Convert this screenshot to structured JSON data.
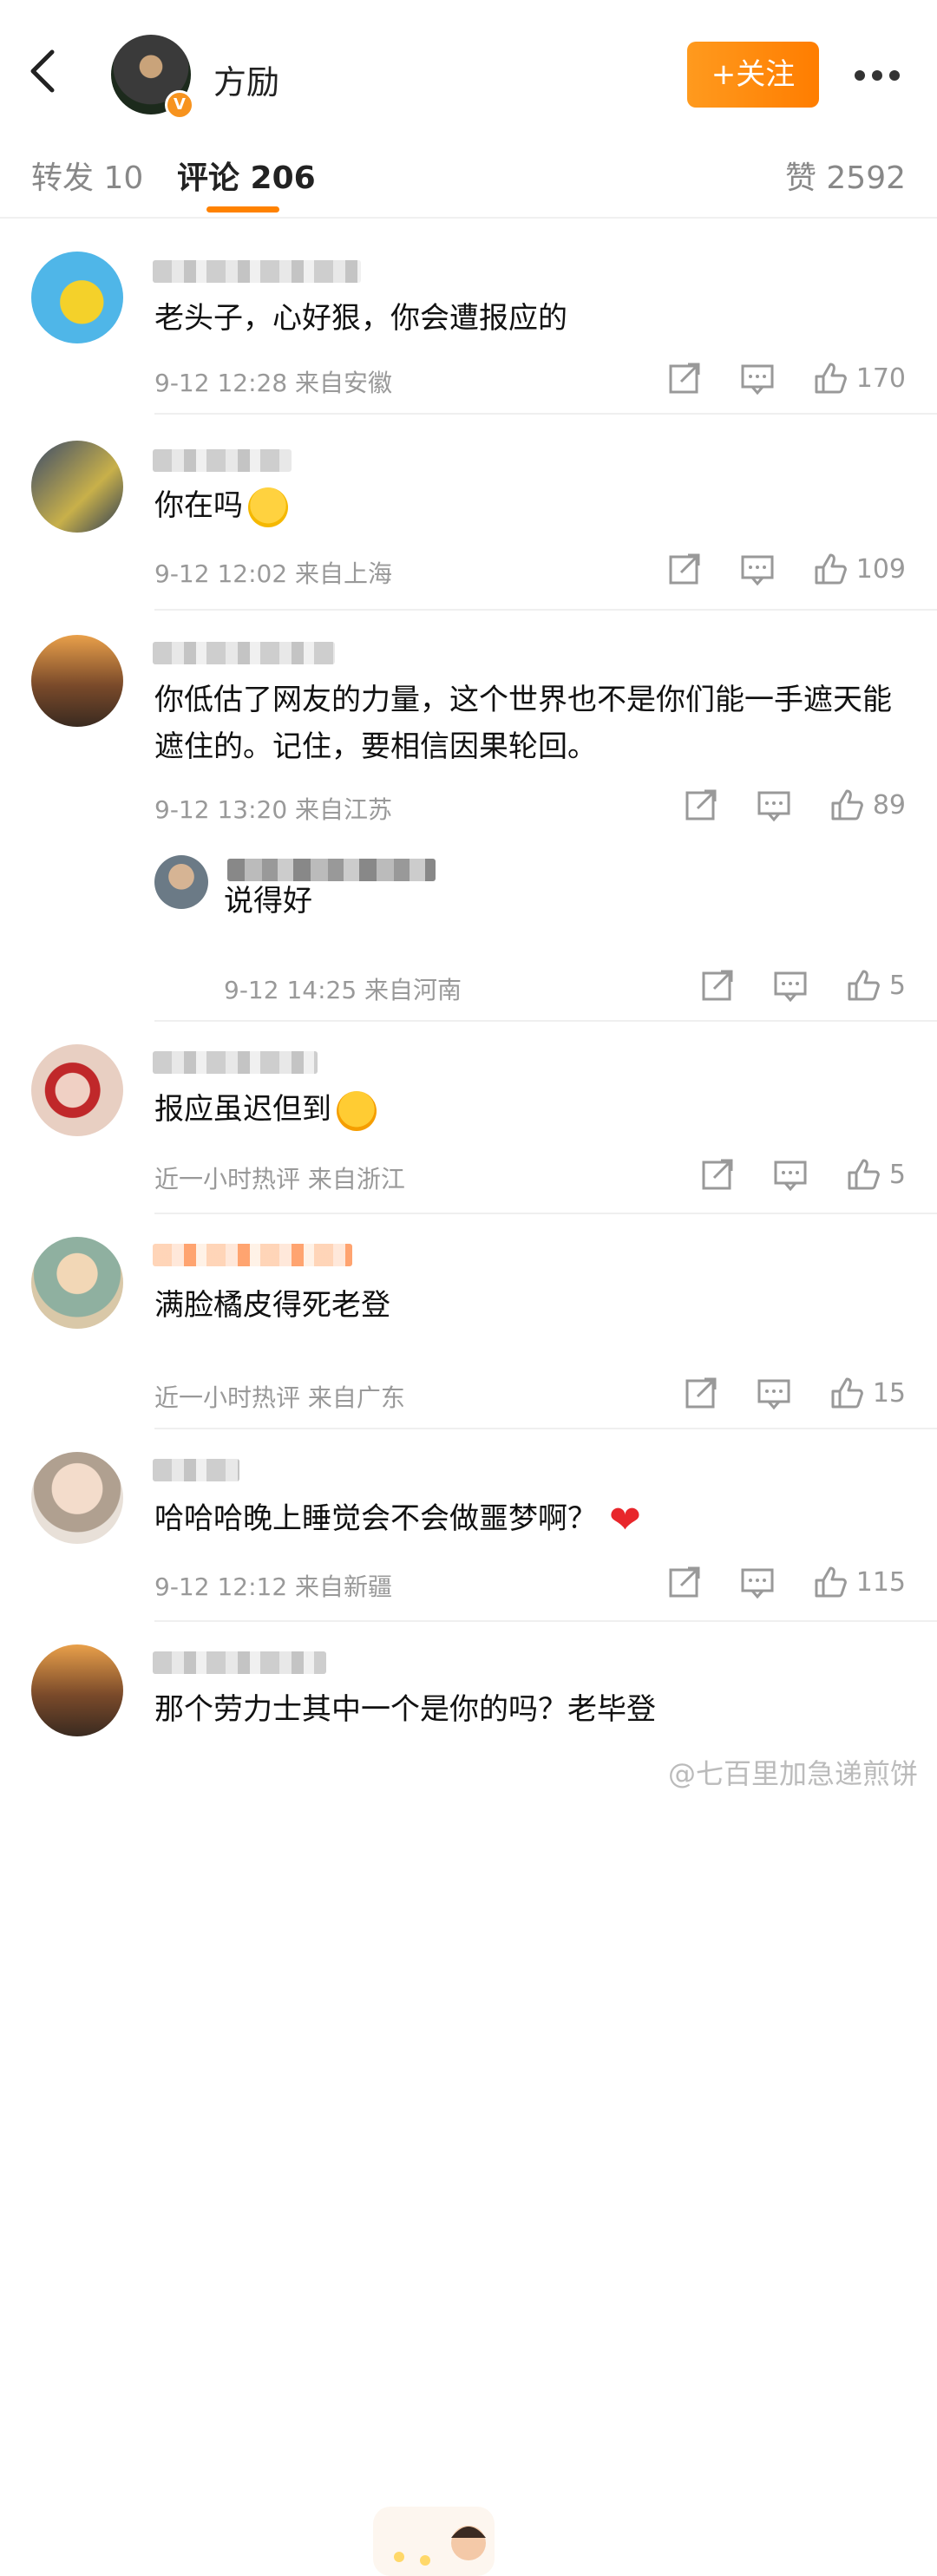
{
  "header": {
    "user_name": "方励",
    "follow_label": "+关注",
    "badge": "V"
  },
  "tabs": {
    "forward": "转发 10",
    "comment": "评论 206",
    "like": "赞 2592"
  },
  "comments": [
    {
      "text": "老头子，心好狠，你会遭报应的",
      "time": "9-12 12:28",
      "location": "来自安徽",
      "likes": "170"
    },
    {
      "text": "你在吗",
      "time": "9-12 12:02",
      "location": "来自上海",
      "likes": "109"
    },
    {
      "text": "你低估了网友的力量，这个世界也不是你们能一手遮天能遮住的。记住，要相信因果轮回。",
      "time": "9-12 13:20",
      "location": "来自江苏",
      "likes": "89"
    },
    {
      "text": "报应虽迟但到",
      "time": "近一小时热评",
      "location": "来自浙江",
      "likes": "5"
    },
    {
      "text": "满脸橘皮得死老登",
      "time": "近一小时热评",
      "location": "来自广东",
      "likes": "15"
    },
    {
      "text": "哈哈哈晚上睡觉会不会做噩梦啊？",
      "time": "9-12 12:12",
      "location": "来自新疆",
      "likes": "115"
    },
    {
      "text": "那个劳力士其中一个是你的吗？老毕登"
    }
  ],
  "reply": {
    "text": "说得好",
    "time": "9-12 14:25",
    "location": "来自河南",
    "likes": "5"
  },
  "watermark": "@七百里加急递煎饼",
  "colors": {
    "accent": "#ff8200",
    "text": "#222222",
    "meta": "#999999"
  }
}
